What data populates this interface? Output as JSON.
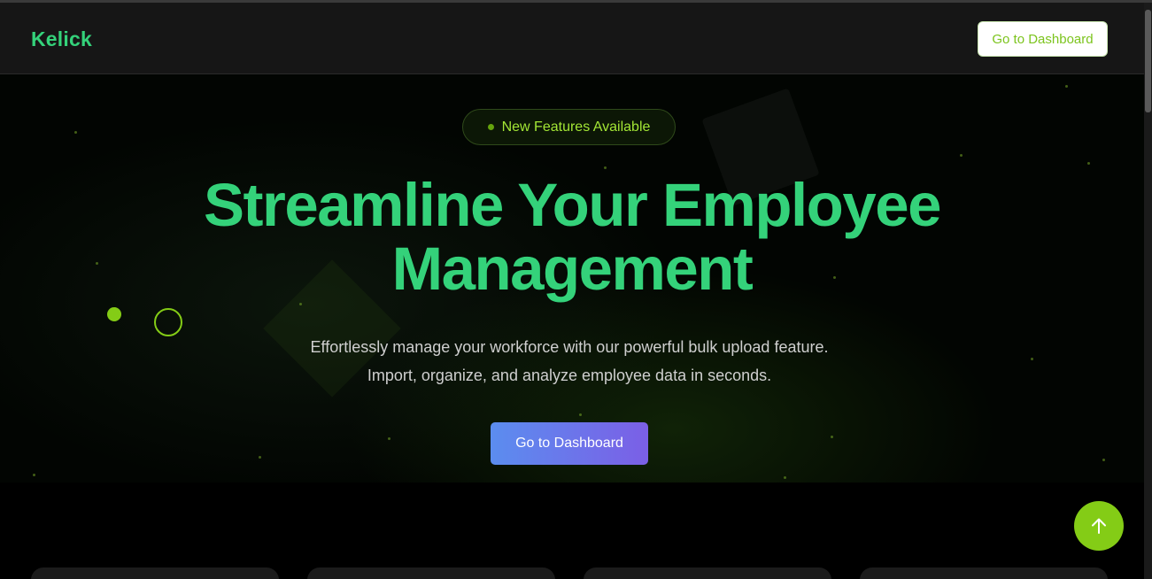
{
  "navbar": {
    "brand": "Kelick",
    "dashboard_button": "Go to Dashboard"
  },
  "hero": {
    "badge_text": "New Features Available",
    "headline_line1": "Streamline Your Employee",
    "headline_line2": "Management",
    "subtext_line1": "Effortlessly manage your workforce with our powerful bulk upload feature.",
    "subtext_line2": "Import, organize, and analyze employee data in seconds.",
    "cta_label": "Go to Dashboard"
  },
  "icons": {
    "scroll_top": "arrow-up-icon"
  },
  "colors": {
    "brand_green": "#34d27a",
    "lime_accent": "#84cc16",
    "cta_gradient_start": "#5b8def",
    "cta_gradient_end": "#7b5fe6",
    "background": "#020202"
  }
}
